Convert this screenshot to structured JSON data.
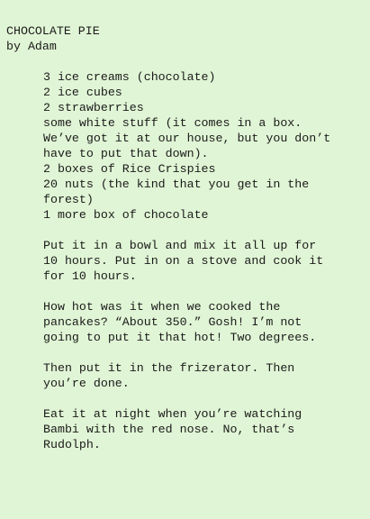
{
  "recipe": {
    "title": "CHOCOLATE PIE",
    "byline": "by Adam",
    "ingredients": [
      "3 ice creams (chocolate)",
      "2 ice cubes",
      "2 strawberries",
      "some white stuff (it comes in a box.",
      "We’ve got it at our house, but you don’t",
      "have to put that down).",
      "2 boxes of Rice Crispies",
      "20 nuts (the kind that you get in the",
      "forest)",
      "1 more box of chocolate"
    ],
    "step1": [
      "Put it in a bowl and mix it all up for",
      "10 hours. Put in on a stove and cook it",
      "for 10 hours."
    ],
    "step2": [
      "How hot was it when we cooked the",
      "pancakes? “About 350.” Gosh! I’m not",
      "going to put it that hot! Two degrees."
    ],
    "step3": [
      "Then put it in the frizerator. Then",
      "you’re done."
    ],
    "step4": [
      "Eat it at night when you’re watching",
      "Bambi with the red nose. No, that’s",
      "Rudolph."
    ]
  }
}
